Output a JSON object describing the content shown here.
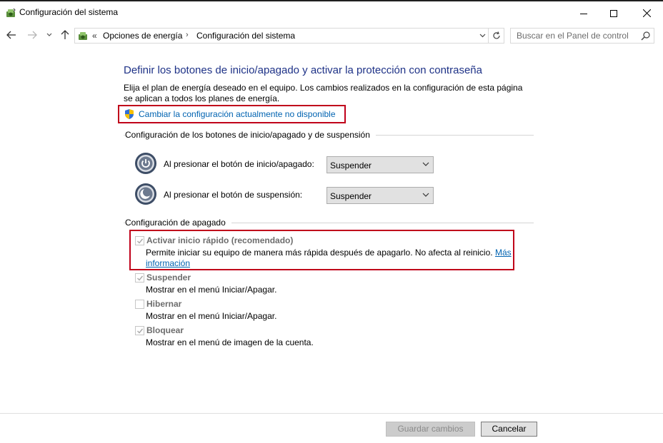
{
  "window": {
    "title": "Configuración del sistema",
    "controls": [
      "minimize-icon",
      "maximize-icon",
      "close-icon"
    ]
  },
  "address": {
    "prefix": "«",
    "breadcrumbs": [
      "Opciones de energía",
      "Configuración del sistema"
    ],
    "separator": "›"
  },
  "search": {
    "placeholder": "Buscar en el Panel de control"
  },
  "main": {
    "heading": "Definir los botones de inicio/apagado y activar la protección con contraseña",
    "description": "Elija el plan de energía deseado en el equipo. Los cambios realizados en la configuración de esta página se aplican a todos los planes de energía.",
    "change_link": "Cambiar la configuración actualmente no disponible"
  },
  "buttons_section": {
    "title": "Configuración de los botones de inicio/apagado y de suspensión",
    "rows": [
      {
        "label": "Al presionar el botón de inicio/apagado:",
        "value": "Suspender"
      },
      {
        "label": "Al presionar el botón de suspensión:",
        "value": "Suspender"
      }
    ]
  },
  "shutdown_section": {
    "title": "Configuración de apagado",
    "options": [
      {
        "title": "Activar inicio rápido (recomendado)",
        "checked": true,
        "description": "Permite iniciar su equipo de manera más rápida después de apagarlo. No afecta al reinicio.",
        "link_line1": "Más",
        "link_line2": "información"
      },
      {
        "title": "Suspender",
        "checked": true,
        "description": "Mostrar en el menú Iniciar/Apagar."
      },
      {
        "title": "Hibernar",
        "checked": false,
        "description": "Mostrar en el menú Iniciar/Apagar."
      },
      {
        "title": "Bloquear",
        "checked": true,
        "description": "Mostrar en el menú de imagen de la cuenta."
      }
    ]
  },
  "footer": {
    "save_label": "Guardar cambios",
    "cancel_label": "Cancelar"
  },
  "colors": {
    "heading": "#1e3287",
    "link": "#0063b1",
    "highlight_box": "#c0001a",
    "disabled_text": "#6d6d6d"
  }
}
